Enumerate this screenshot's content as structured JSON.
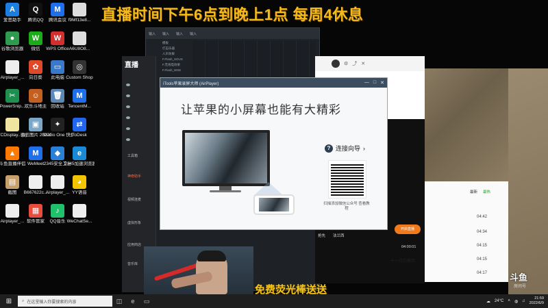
{
  "overlay": {
    "title": "直播时间下午6点到晚上1点 每周4休息",
    "bottom": "免费荧光棒送送"
  },
  "desktop_icons": [
    {
      "label": "爱思助手",
      "icon": "aisi-icon",
      "color": "#1a7fe0",
      "glyph": "A"
    },
    {
      "label": "腾讯QQ",
      "icon": "qq-icon",
      "color": "#111",
      "glyph": "Q"
    },
    {
      "label": "腾讯会议",
      "icon": "tencent-meeting-icon",
      "color": "#1f6fea",
      "glyph": "M"
    },
    {
      "label": "f9Mf13e8...",
      "icon": "file-icon",
      "color": "#ddd",
      "glyph": ""
    },
    {
      "label": "谷歌浏览器",
      "icon": "chrome-icon",
      "color": "#2e9b4e",
      "glyph": "●"
    },
    {
      "label": "微信",
      "icon": "wechat-icon",
      "color": "#1aad19",
      "glyph": "W"
    },
    {
      "label": "WPS Office",
      "icon": "wps-icon",
      "color": "#d32f2f",
      "glyph": "W"
    },
    {
      "label": "A6U8O8...",
      "icon": "file-icon",
      "color": "#ddd",
      "glyph": ""
    },
    {
      "label": "Airplayer_...",
      "icon": "file-icon",
      "color": "#eee",
      "glyph": ""
    },
    {
      "label": "向日葵",
      "icon": "sunflower-icon",
      "color": "#e0482a",
      "glyph": "✿"
    },
    {
      "label": "此电脑",
      "icon": "pc-icon",
      "color": "#3a78c9",
      "glyph": "▭"
    },
    {
      "label": "Custom Shop",
      "icon": "custom-shop-icon",
      "color": "#333",
      "glyph": "◎"
    },
    {
      "label": "PowerSnip...",
      "icon": "powersnip-icon",
      "color": "#1e8f4e",
      "glyph": "✂"
    },
    {
      "label": "欢乐斗地主",
      "icon": "doudizhu-icon",
      "color": "#c4601f",
      "glyph": "☺"
    },
    {
      "label": "回收站",
      "icon": "recycle-bin-icon",
      "color": "#5d87b5",
      "glyph": "🗑"
    },
    {
      "label": "TencentM...",
      "icon": "tencent-meeting-icon",
      "color": "#1f6fea",
      "glyph": "M"
    },
    {
      "label": "TCDisplay...(1)",
      "icon": "file-icon",
      "color": "#f1e3a0",
      "glyph": ""
    },
    {
      "label": "微信图片 2022040...",
      "icon": "image-icon",
      "color": "#7aa7c8",
      "glyph": "▣"
    },
    {
      "label": "Studio One 快捷方式",
      "icon": "studio-one-icon",
      "color": "#222",
      "glyph": "✦"
    },
    {
      "label": "ToDesk",
      "icon": "todesk-icon",
      "color": "#2266ee",
      "glyph": "⇄"
    },
    {
      "label": "斗鱼直播伴侣",
      "icon": "douyu-companion-icon",
      "color": "#ff7a00",
      "glyph": "▲"
    },
    {
      "label": "WeMeet",
      "icon": "wemeet-icon",
      "color": "#1f6fea",
      "glyph": "M"
    },
    {
      "label": "2345安全卫士",
      "icon": "2345-guard-icon",
      "color": "#2a7fd6",
      "glyph": "◆"
    },
    {
      "label": "2345加速浏览器",
      "icon": "2345-browser-icon",
      "color": "#1b8ad6",
      "glyph": "e"
    },
    {
      "label": "截图",
      "icon": "screenshot-icon",
      "color": "#c9a06b",
      "glyph": "▤"
    },
    {
      "label": "B667622c...",
      "icon": "file-icon",
      "color": "#eee",
      "glyph": ""
    },
    {
      "label": "Airplayer_...",
      "icon": "file-icon",
      "color": "#eee",
      "glyph": ""
    },
    {
      "label": "YY语音",
      "icon": "yy-icon",
      "color": "#f3c400",
      "glyph": "◕"
    },
    {
      "label": "Airplayer_...",
      "icon": "file-icon",
      "color": "#eee",
      "glyph": ""
    },
    {
      "label": "软件管家",
      "icon": "software-manager-icon",
      "color": "#e84c3d",
      "glyph": "▦"
    },
    {
      "label": "QQ音乐",
      "icon": "qq-music-icon",
      "color": "#1fc26b",
      "glyph": "♪"
    },
    {
      "label": "WeChatSe...",
      "icon": "file-icon",
      "color": "#eee",
      "glyph": ""
    }
  ],
  "mixer": {
    "tabs": [
      "输入",
      "输入",
      "输入",
      "输入"
    ],
    "tree": [
      "模板",
      "打击乐器",
      "人声效果",
      "F.Flash_SOUS",
      "F.无线电效果",
      "F.Flash_WSE"
    ]
  },
  "live_app": {
    "logo": "直播",
    "items": [
      "工具箱",
      "神奇助手",
      "视频连麦",
      "虚拟形象",
      "应用商店"
    ],
    "bottom_label": "音乐库"
  },
  "itools": {
    "window_title": "iTools苹果录屏大师 (AirPlayer)",
    "slogan": "让苹果的小屏幕也能有大精彩",
    "guide_label": "连接向导",
    "qr_text": "扫描添加微信公众号 查看教程",
    "controls": [
      "—",
      "□",
      "✕"
    ]
  },
  "browser": {
    "rows": [
      "抢先",
      "法兰西"
    ],
    "orange_button": "开启直播",
    "stat": "04:00:01"
  },
  "right_panel": {
    "tabs": [
      "最新",
      "最热"
    ],
    "times": [
      "04:42",
      "04:34",
      "04:15",
      "04:15",
      "04:17"
    ],
    "entry": "十一月的萧邦"
  },
  "watermark": {
    "brand": "斗鱼",
    "room": "房间号"
  },
  "taskbar": {
    "search_placeholder": "在这里输入你要搜索的内容",
    "weather": "24°C",
    "time": "21:59",
    "date": "2022/6/9"
  }
}
